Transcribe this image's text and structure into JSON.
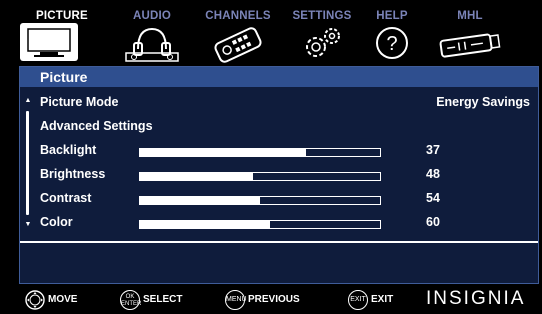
{
  "tabs": [
    {
      "label": "PICTURE",
      "icon": "tv-icon",
      "active": true
    },
    {
      "label": "AUDIO",
      "icon": "headphones-icon",
      "active": false
    },
    {
      "label": "CHANNELS",
      "icon": "remote-control-icon",
      "active": false
    },
    {
      "label": "SETTINGS",
      "icon": "gears-icon",
      "active": false
    },
    {
      "label": "HELP",
      "icon": "help-icon",
      "active": false
    },
    {
      "label": "MHL",
      "icon": "mhl-cable-icon",
      "active": false
    }
  ],
  "panel": {
    "title": "Picture",
    "picture_mode": {
      "label": "Picture Mode",
      "value": "Energy Savings"
    },
    "advanced_settings": {
      "label": "Advanced Settings"
    },
    "sliders": [
      {
        "label": "Backlight",
        "value": "37",
        "level": 0.69
      },
      {
        "label": "Brightness",
        "value": "48",
        "level": 0.47
      },
      {
        "label": "Contrast",
        "value": "54",
        "level": 0.5
      },
      {
        "label": "Color",
        "value": "60",
        "level": 0.54
      }
    ]
  },
  "hints": [
    {
      "key": "",
      "label": "MOVE",
      "icon": "dpad-icon"
    },
    {
      "key": "OK ENTER",
      "label": "SELECT",
      "icon": "ok-button-icon"
    },
    {
      "key": "MENU",
      "label": "PREVIOUS",
      "icon": "menu-button-icon"
    },
    {
      "key": "EXIT",
      "label": "EXIT",
      "icon": "exit-button-icon"
    }
  ],
  "brand": "INSIGNIA",
  "colors": {
    "panel_bg": "#0f1c3c",
    "title_bar": "#2f4f8f",
    "inactive_tab": "#7b84b8",
    "active_tab": "#ffffff"
  }
}
